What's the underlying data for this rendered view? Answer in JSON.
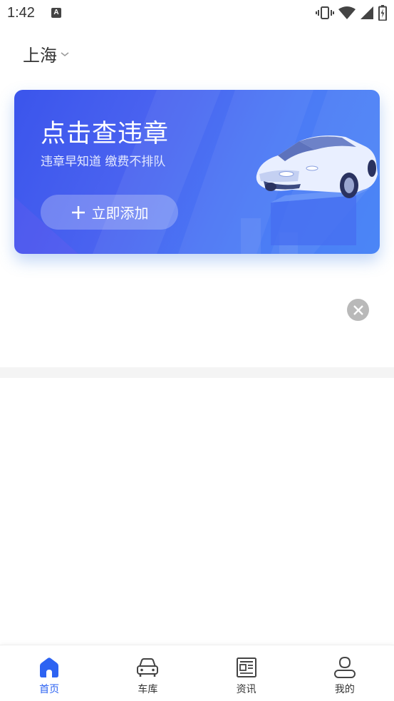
{
  "status_bar": {
    "time": "1:42",
    "notification_icon": "A"
  },
  "city": {
    "label": "上海",
    "icon": "chevron-down-icon"
  },
  "banner": {
    "title": "点击查违章",
    "subtitle": "违章早知道 缴费不排队",
    "add_button_label": "立即添加",
    "add_icon": "plus-icon",
    "image": "sports-car-illustration"
  },
  "close_button": {
    "icon": "close-icon"
  },
  "bottom_nav": {
    "items": [
      {
        "label": "首页",
        "icon": "home-icon",
        "active": true
      },
      {
        "label": "车库",
        "icon": "car-icon",
        "active": false
      },
      {
        "label": "资讯",
        "icon": "newspaper-icon",
        "active": false
      },
      {
        "label": "我的",
        "icon": "user-icon",
        "active": false
      }
    ]
  },
  "colors": {
    "accent": "#2d63f2",
    "banner_start": "#3b55ec",
    "banner_end": "#4b86f6",
    "divider": "#f4f4f4"
  }
}
